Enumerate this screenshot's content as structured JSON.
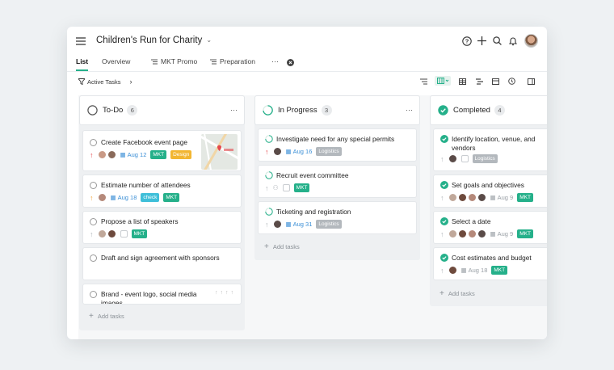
{
  "header": {
    "project_title": "Children's Run for Charity"
  },
  "tabs": [
    {
      "label": "List"
    },
    {
      "label": "Overview"
    },
    {
      "label": "MKT Promo"
    },
    {
      "label": "Preparation"
    }
  ],
  "filter": {
    "label": "Active Tasks"
  },
  "columns": {
    "todo": {
      "name": "To-Do",
      "count": "6",
      "add_label": "Add tasks"
    },
    "inprogress": {
      "name": "In Progress",
      "count": "3",
      "add_label": "Add tasks"
    },
    "completed": {
      "name": "Completed",
      "count": "4",
      "add_label": "Add tasks"
    }
  },
  "cards": {
    "t1": {
      "title": "Create Facebook event page",
      "date": "Aug 12",
      "tags": [
        "MKT",
        "Design"
      ]
    },
    "t2": {
      "title": "Estimate number of attendees",
      "date": "Aug 18",
      "tags": [
        "check",
        "MKT"
      ]
    },
    "t3": {
      "title": "Propose a list of speakers",
      "tags": [
        "MKT"
      ]
    },
    "t4": {
      "title": "Draft and sign agreement with sponsors"
    },
    "t5": {
      "title": "Brand - event logo, social media images"
    },
    "p1": {
      "title": "Investigate need for any special permits",
      "date": "Aug 16",
      "tags": [
        "Logistics"
      ]
    },
    "p2": {
      "title": "Recruit event committee",
      "tags": [
        "MKT"
      ]
    },
    "p3": {
      "title": "Ticketing and registration",
      "date": "Aug 31",
      "tags": [
        "Logistics"
      ]
    },
    "c1": {
      "title": "Identify location, venue, and vendors",
      "tags": [
        "Logistics"
      ]
    },
    "c2": {
      "title": "Set goals and objectives",
      "date": "Aug 9",
      "tags": [
        "MKT"
      ]
    },
    "c3": {
      "title": "Select a date",
      "date": "Aug 9",
      "tags": [
        "MKT"
      ]
    },
    "c4": {
      "title": "Cost estimates and budget",
      "date": "Aug 18",
      "tags": [
        "MKT"
      ]
    }
  },
  "colors": {
    "accent": "#25b08a",
    "mkt": "#25b08a",
    "design": "#f2b632",
    "check": "#3fbfd9",
    "logistics": "#b3b8bd",
    "date": "#3b8fd6",
    "priority_high": "#e5484d",
    "priority_mid": "#f2a33a"
  }
}
